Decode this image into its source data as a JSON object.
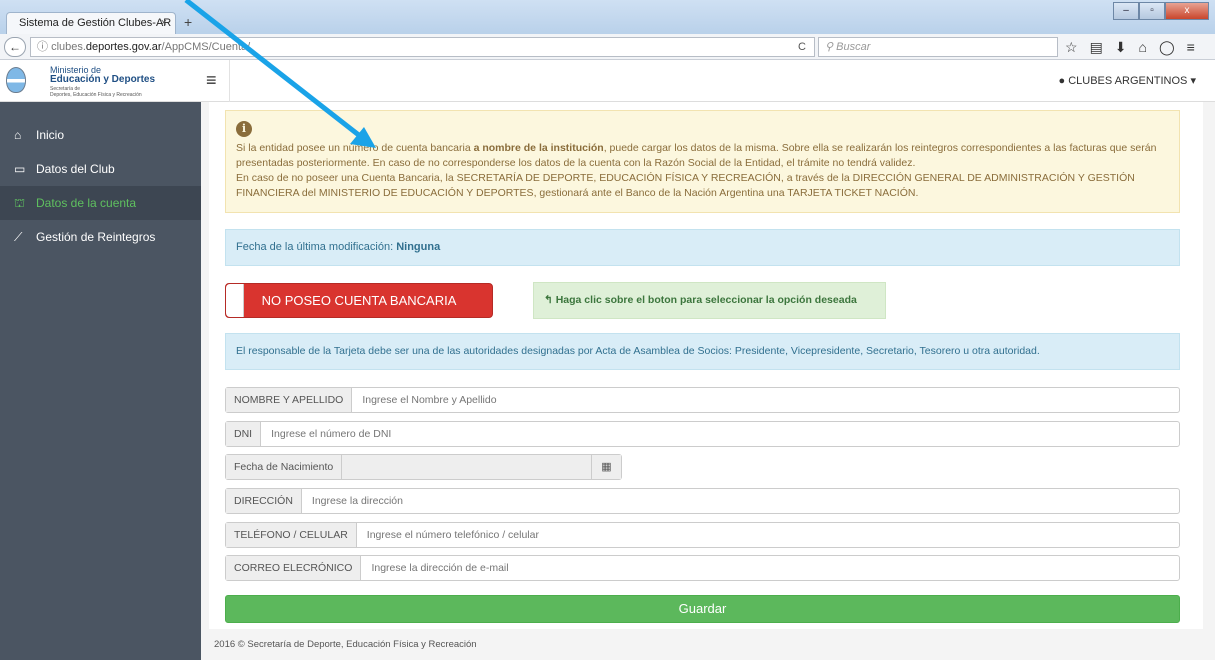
{
  "browser": {
    "tab_title": "Sistema de Gestión Clubes-AR",
    "tab_close": "×",
    "new_tab": "+",
    "url_prefix": "clubes.",
    "url_domain": "deportes.gov.ar",
    "url_path": "/AppCMS/Cuenta/",
    "reload": "C",
    "search_placeholder": "Buscar"
  },
  "logo": {
    "line1": "Ministerio de",
    "line2": "Educación y Deportes",
    "line3": "Secretaría de",
    "line4": "Deportes, Educación Física y Recreación"
  },
  "sidebar": {
    "items": [
      {
        "label": "Inicio",
        "icon": "home-icon"
      },
      {
        "label": "Datos del Club",
        "icon": "folder-icon"
      },
      {
        "label": "Datos de la cuenta",
        "icon": "bank-icon"
      },
      {
        "label": "Gestión de Reintegros",
        "icon": "chart-icon"
      }
    ]
  },
  "topbar": {
    "user_label": "CLUBES ARGENTINOS"
  },
  "warning": {
    "part1": "Si la entidad posee un número de cuenta bancaria ",
    "bold": "a nombre de la institución",
    "part2": ", puede cargar los datos de la misma. Sobre ella se realizarán los reintegros correspondientes a las facturas que serán presentadas posteriormente. En caso de no corresponderse los datos de la cuenta con la Razón Social de la Entidad, el trámite no tendrá validez.",
    "para2": "En caso de no poseer una Cuenta Bancaria, la SECRETARÍA DE DEPORTE, EDUCACIÓN FÍSICA Y RECREACIÓN, a través de la DIRECCIÓN GENERAL DE ADMINISTRACIÓN Y GESTIÓN FINANCIERA del MINISTERIO DE EDUCACIÓN Y DEPORTES, gestionará ante el Banco de la Nación Argentina una TARJETA TICKET NACIÓN."
  },
  "last_modified": {
    "label": "Fecha de la última modificación: ",
    "value": "Ninguna"
  },
  "toggle_button": "NO POSEO CUENTA BANCARIA",
  "hint": "Haga clic sobre el boton para seleccionar la opción deseada",
  "responsible_note": "El responsable de la Tarjeta debe ser una de las autoridades designadas por Acta de Asamblea de Socios: Presidente, Vicepresidente, Secretario, Tesorero u otra autoridad.",
  "form": {
    "name_label": "NOMBRE Y APELLIDO",
    "name_placeholder": "Ingrese el Nombre y Apellido",
    "dni_label": "DNI",
    "dni_placeholder": "Ingrese el número de DNI",
    "birth_label": "Fecha de Nacimiento",
    "address_label": "DIRECCIÓN",
    "address_placeholder": "Ingrese la dirección",
    "phone_label": "TELÉFONO / CELULAR",
    "phone_placeholder": "Ingrese el número telefónico / celular",
    "email_label": "CORREO ELECRÓNICO",
    "email_placeholder": "Ingrese la dirección de e-mail"
  },
  "save_button": "Guardar",
  "footer": "2016 © Secretaría de Deporte, Educación Física y Recreación",
  "colors": {
    "arrow": "#1aa3e8",
    "active_menu": "#5fc05f",
    "danger": "#d9342f",
    "success": "#5cb85c"
  }
}
